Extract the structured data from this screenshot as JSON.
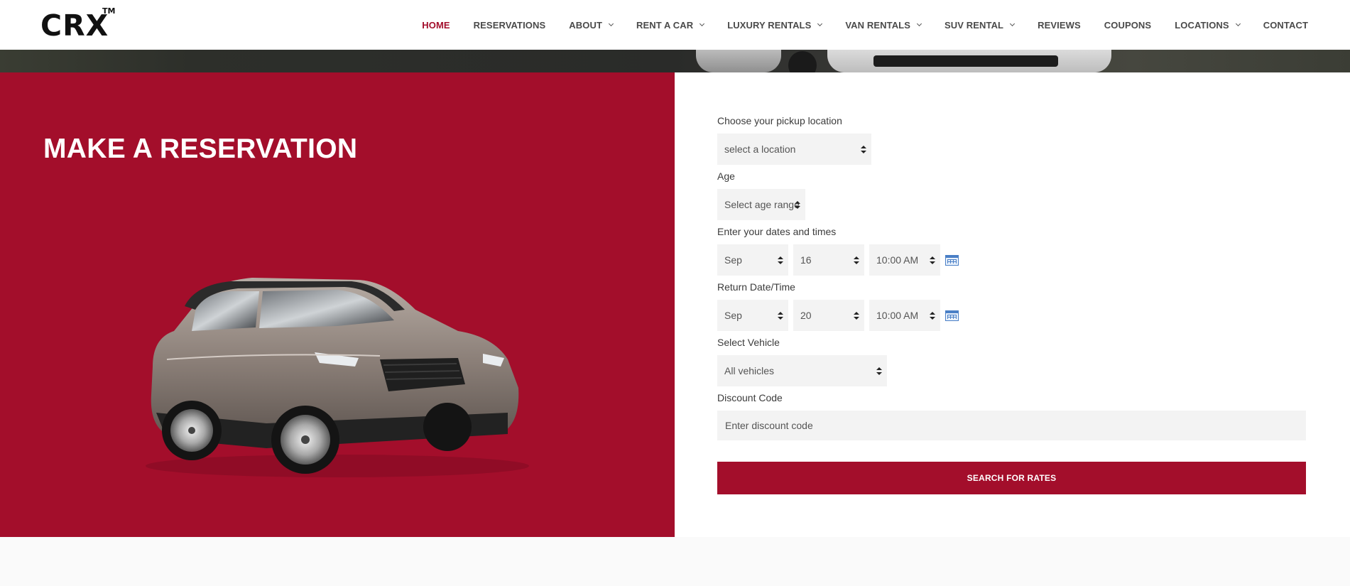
{
  "header": {
    "logo": "CRX",
    "logo_tm": "TM",
    "nav": [
      {
        "label": "HOME",
        "active": true,
        "dropdown": false
      },
      {
        "label": "RESERVATIONS",
        "active": false,
        "dropdown": false
      },
      {
        "label": "ABOUT",
        "active": false,
        "dropdown": true
      },
      {
        "label": "RENT A CAR",
        "active": false,
        "dropdown": true
      },
      {
        "label": "LUXURY RENTALS",
        "active": false,
        "dropdown": true
      },
      {
        "label": "VAN RENTALS",
        "active": false,
        "dropdown": true
      },
      {
        "label": "SUV RENTAL",
        "active": false,
        "dropdown": true
      },
      {
        "label": "REVIEWS",
        "active": false,
        "dropdown": false
      },
      {
        "label": "COUPONS",
        "active": false,
        "dropdown": false
      },
      {
        "label": "LOCATIONS",
        "active": false,
        "dropdown": true
      },
      {
        "label": "CONTACT",
        "active": false,
        "dropdown": false
      }
    ]
  },
  "reservation": {
    "title": "MAKE A RESERVATION"
  },
  "form": {
    "pickup_location_label": "Choose your pickup location",
    "pickup_location_value": "select a location",
    "age_label": "Age",
    "age_value": "Select age range",
    "dates_label": "Enter your dates and times",
    "pickup_month": "Sep",
    "pickup_day": "16",
    "pickup_time": "10:00 AM",
    "return_label": "Return Date/Time",
    "return_month": "Sep",
    "return_day": "20",
    "return_time": "10:00 AM",
    "vehicle_label": "Select Vehicle",
    "vehicle_value": "All vehicles",
    "discount_label": "Discount Code",
    "discount_placeholder": "Enter discount code",
    "submit_label": "SEARCH FOR RATES"
  },
  "colors": {
    "brand_red": "#a30e2b",
    "field_bg": "#f3f3f3"
  }
}
